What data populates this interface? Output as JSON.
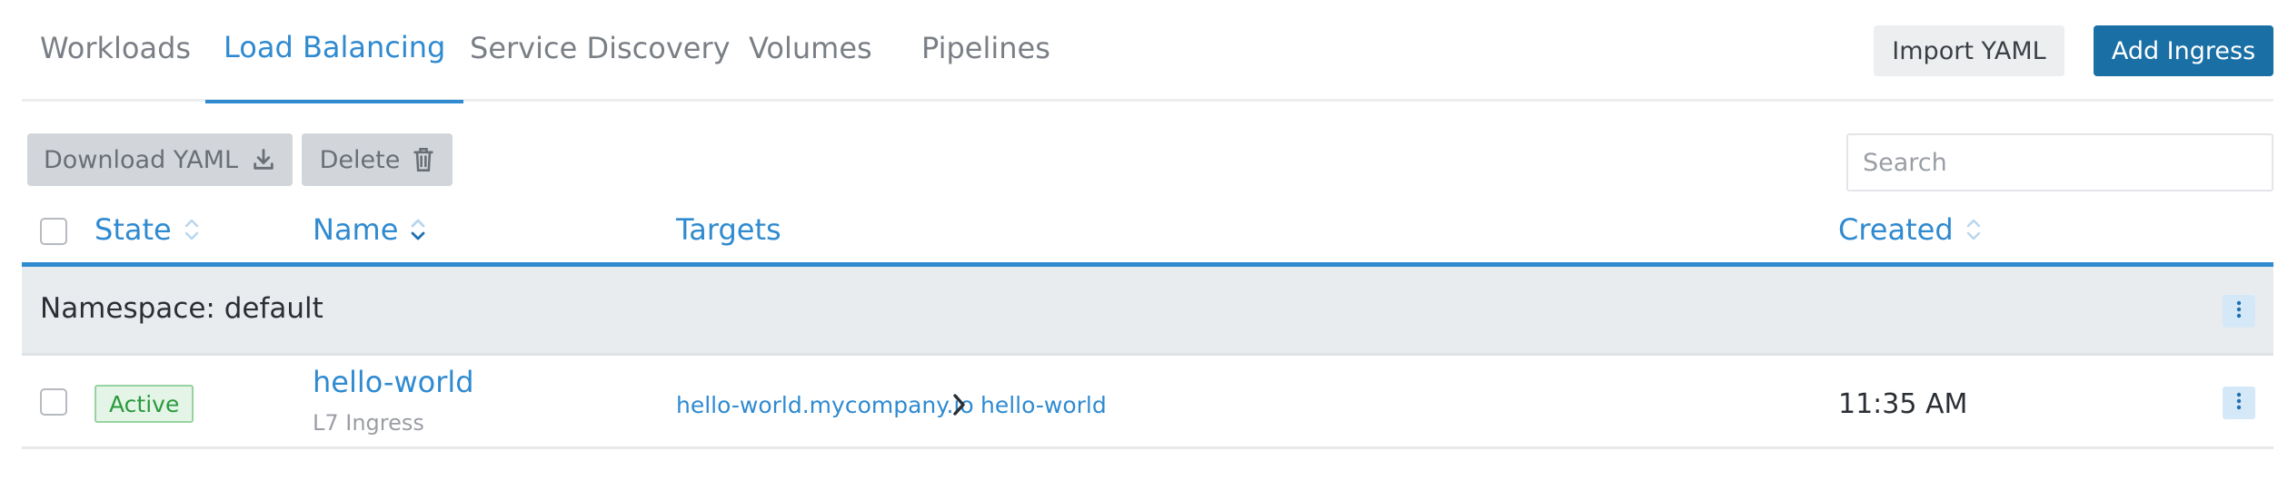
{
  "nav": {
    "tabs": [
      {
        "label": "Workloads",
        "active": false
      },
      {
        "label": "Load Balancing",
        "active": true
      },
      {
        "label": "Service Discovery",
        "active": false
      },
      {
        "label": "Volumes",
        "active": false
      },
      {
        "label": "Pipelines",
        "active": false
      }
    ]
  },
  "header_actions": {
    "import_label": "Import YAML",
    "add_label": "Add Ingress"
  },
  "bulk_actions": {
    "download_label": "Download YAML",
    "download_icon": "download-icon",
    "delete_label": "Delete",
    "delete_icon": "trash-icon"
  },
  "search": {
    "placeholder": "Search",
    "value": ""
  },
  "table": {
    "columns": {
      "state": "State",
      "name": "Name",
      "targets": "Targets",
      "created": "Created"
    },
    "groups": [
      {
        "label": "Namespace: default",
        "rows": [
          {
            "state": "Active",
            "name": "hello-world",
            "type": "L7 Ingress",
            "target_host": "hello-world.mycompany.io",
            "target_service": "hello-world",
            "created": "11:35 AM"
          }
        ]
      }
    ]
  },
  "colors": {
    "accent": "#2f8ad0",
    "primary_button": "#1a6fa5",
    "active_badge": "#2a9a3d",
    "group_bg": "#e9ecee"
  }
}
